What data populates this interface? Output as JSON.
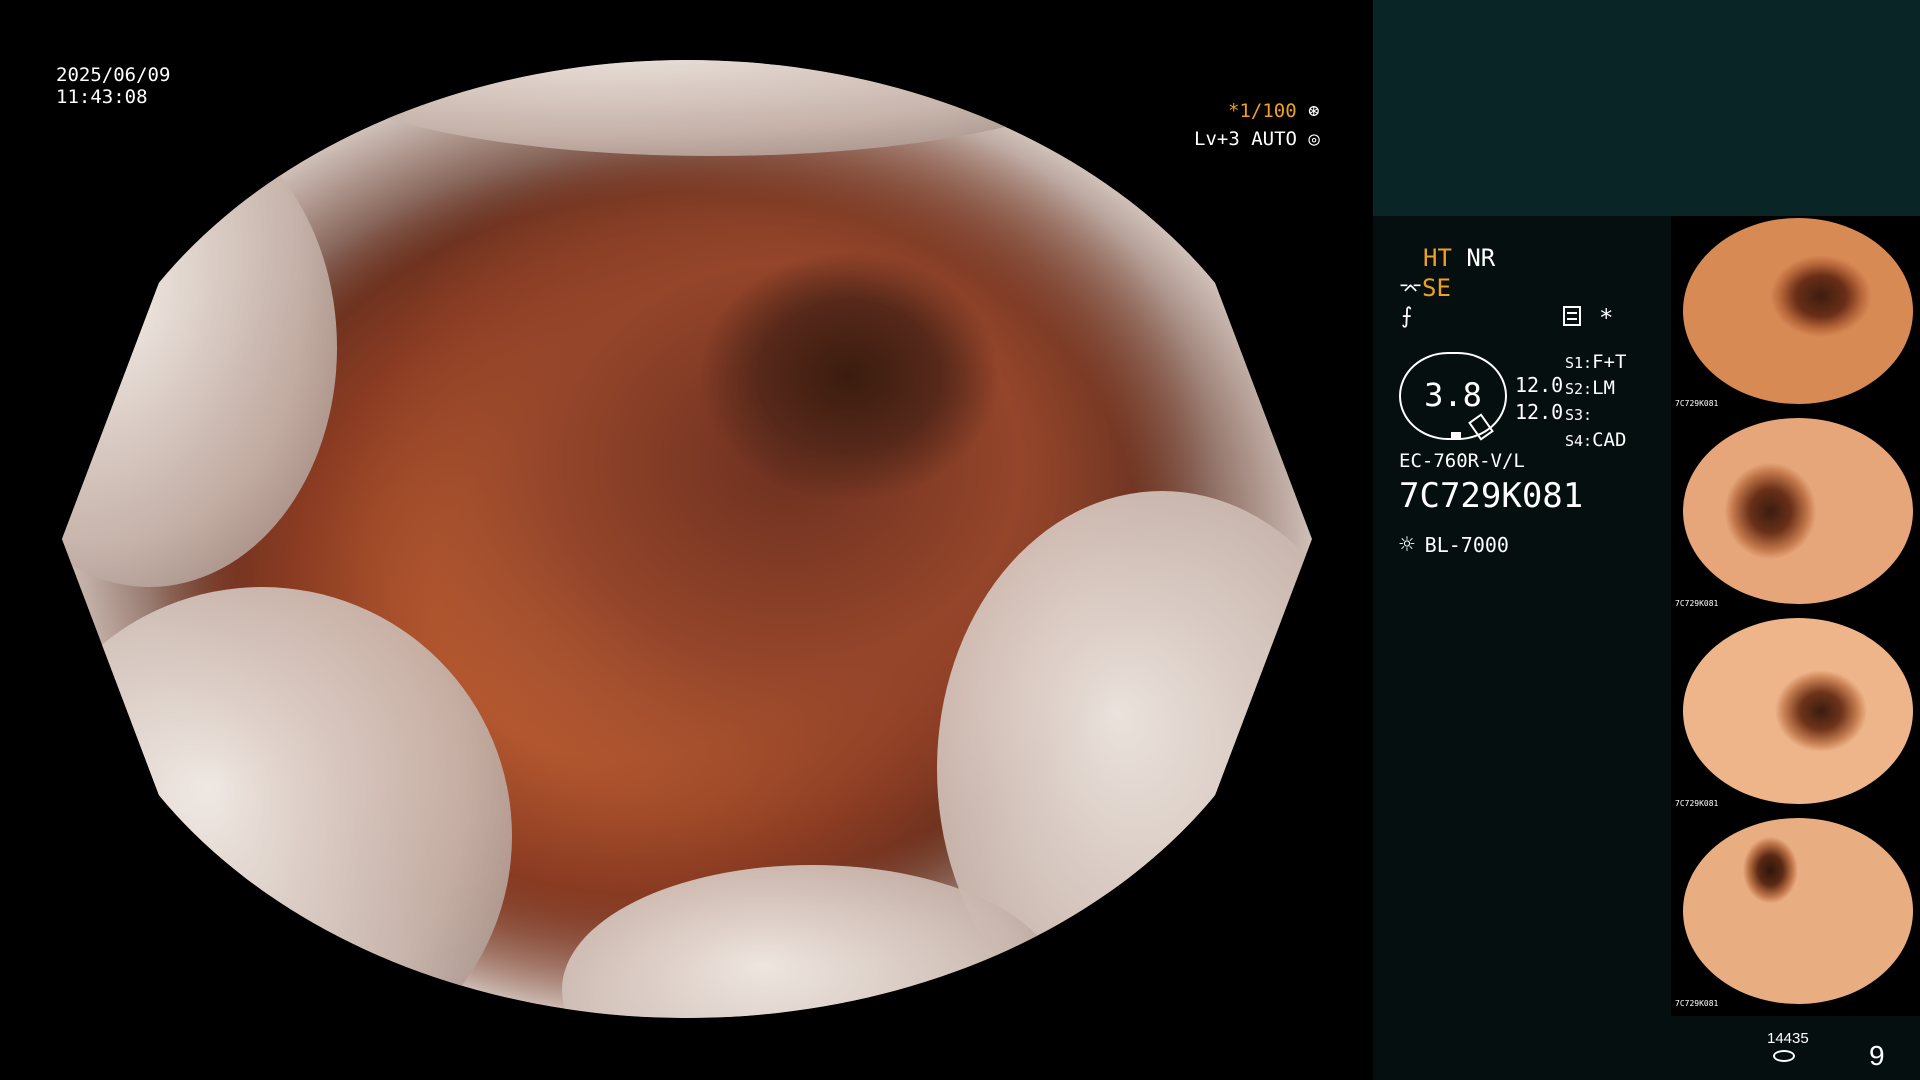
{
  "main": {
    "date": "2025/06/09",
    "time": "11:43:08",
    "shutter": "*1/100",
    "iris": "Lv+3 AUTO"
  },
  "side": {
    "ht": "HT",
    "nr": "NR",
    "se": "SE",
    "star": "*",
    "gauge_value": "3.8",
    "val1": "12.0",
    "val2": "12.0",
    "s1_key": "S1:",
    "s1_val": "F+T",
    "s2_key": "S2:",
    "s2_val": "LM",
    "s3_key": "S3:",
    "s3_val": "",
    "s4_key": "S4:",
    "s4_val": "CAD",
    "scope_model": "EC-760R-V/L",
    "scope_serial": "7C729K081",
    "light_source": "BL-7000",
    "image_count": "14435",
    "page_number": "9",
    "thumb_label": "7C729K081"
  },
  "colors": {
    "accent_orange": "#f0a020",
    "panel_bg": "#060f10",
    "panel_top": "#0a2526"
  }
}
